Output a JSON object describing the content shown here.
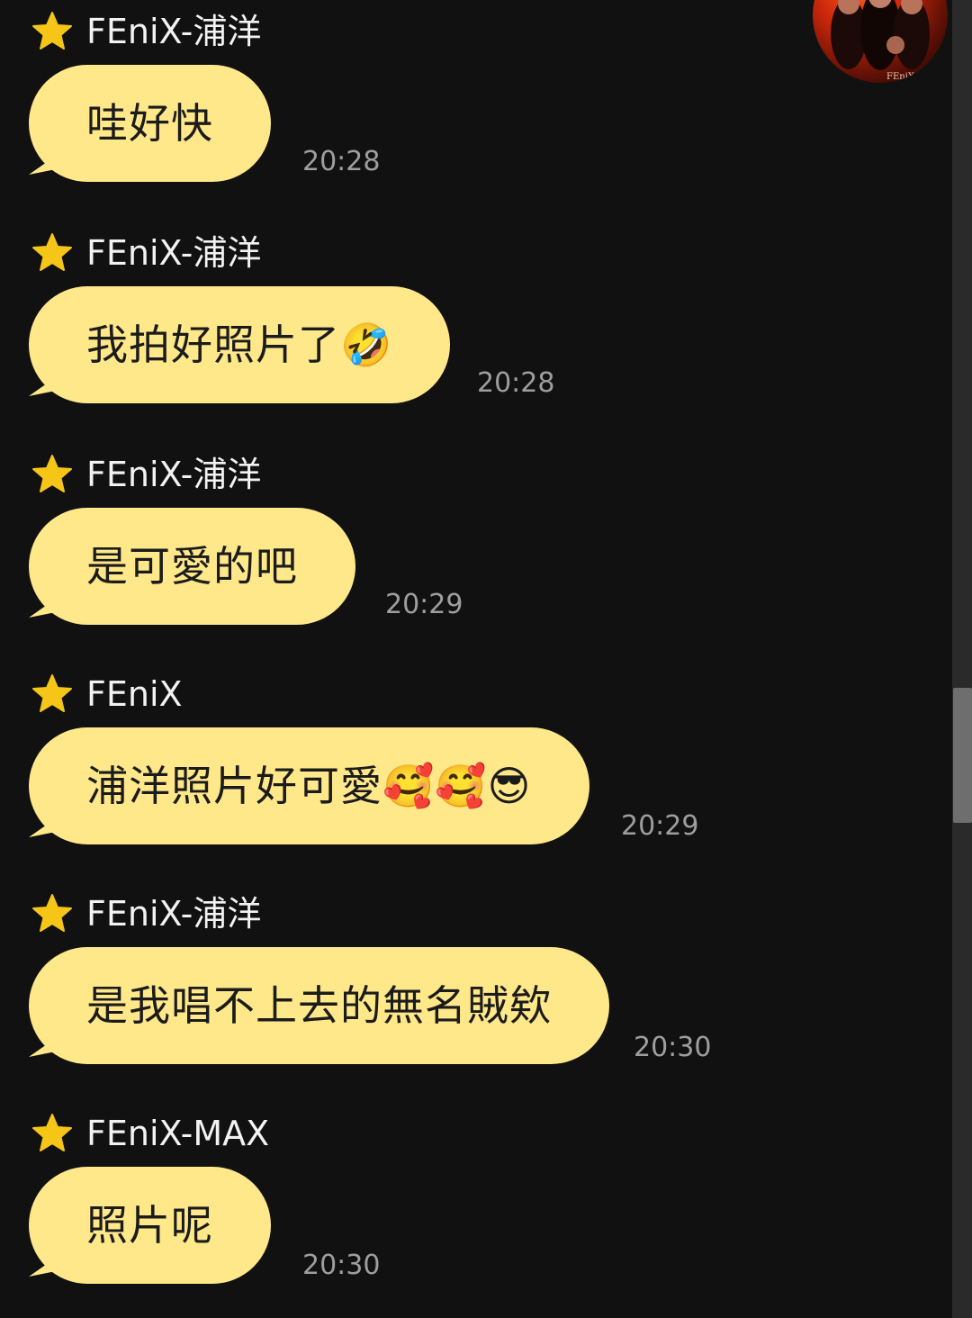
{
  "chat": {
    "avatar_icon": "group-avatar-photo",
    "avatar_text": "FEniX",
    "messages": [
      {
        "sender": "FEniX-浦洋",
        "text": "哇好快",
        "time": "20:28"
      },
      {
        "sender": "FEniX-浦洋",
        "text": "我拍好照片了🤣",
        "time": "20:28"
      },
      {
        "sender": "FEniX-浦洋",
        "text": "是可愛的吧",
        "time": "20:29"
      },
      {
        "sender": "FEniX",
        "text": "浦洋照片好可愛🥰🥰😎",
        "time": "20:29"
      },
      {
        "sender": "FEniX-浦洋",
        "text": "是我唱不上去的無名賊欸",
        "time": "20:30"
      },
      {
        "sender": "FEniX-MAX",
        "text": "照片呢",
        "time": "20:30"
      }
    ]
  },
  "colors": {
    "background": "#111111",
    "bubble": "#ffe88a",
    "star": "#f5c518",
    "sender_text": "#f2f2f2",
    "time_text": "#9e9e9e",
    "scrollbar_thumb": "#6e6e6e"
  }
}
